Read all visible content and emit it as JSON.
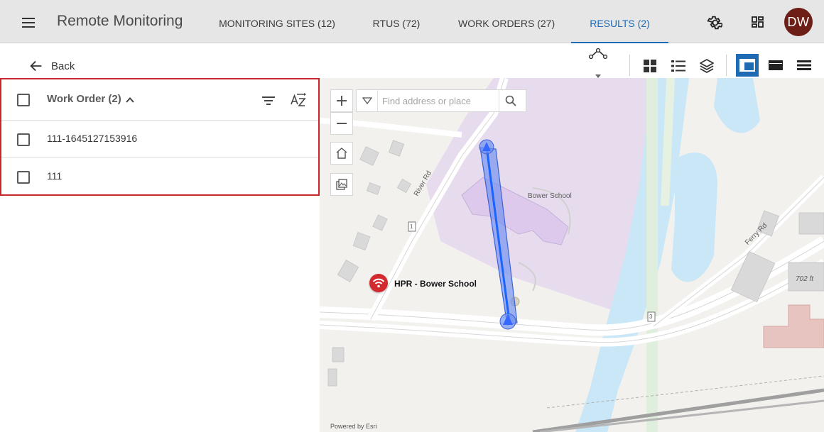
{
  "app": {
    "title": "Remote Monitoring",
    "avatar_initials": "DW",
    "avatar_color": "#6d1e16",
    "accent_color": "#1f6bb3"
  },
  "nav": {
    "tabs": [
      {
        "label": "MONITORING SITES (12)",
        "active": false
      },
      {
        "label": "RTUS (72)",
        "active": false
      },
      {
        "label": "WORK ORDERS (27)",
        "active": false
      },
      {
        "label": "RESULTS (2)",
        "active": true
      }
    ]
  },
  "toolbar": {
    "back_label": "Back"
  },
  "work_orders": {
    "header_label": "Work Order (2)",
    "items": [
      {
        "label": "111-1645127153916"
      },
      {
        "label": "111"
      }
    ]
  },
  "map": {
    "search_placeholder": "Find address or place",
    "site_label": "HPR - Bower School",
    "place_label": "Bower School",
    "road_river": "River Rd",
    "road_ferry": "Ferry Rd",
    "road_shield_1": "1",
    "road_shield_3": "3",
    "elevation_label": "702 ft",
    "attribution": "Powered by Esri"
  },
  "icons": {
    "menu": "hamburger-icon",
    "settings": "gear-icon",
    "apps": "grid-apps-icon",
    "back": "arrow-left-icon",
    "route": "route-nodes-icon",
    "grid_view": "grid-view-icon",
    "list_view": "list-view-icon",
    "layers": "layers-icon",
    "filter": "filter-icon",
    "sort": "sort-az-icon",
    "zoom_in": "plus-icon",
    "zoom_out": "minus-icon",
    "home": "home-icon",
    "basemap": "basemap-icon",
    "search": "search-icon",
    "wifi": "wifi-icon"
  }
}
